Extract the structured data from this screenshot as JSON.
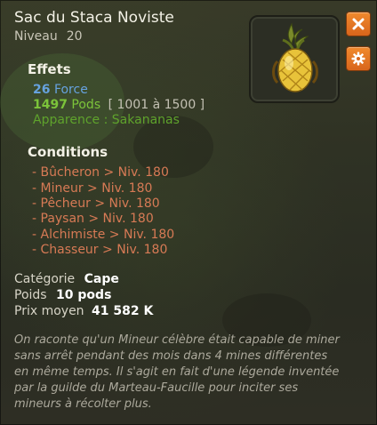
{
  "item": {
    "name": "Sac du Staca Noviste",
    "level_label": "Niveau",
    "level_value": "20"
  },
  "buttons": {
    "close_icon": "close-icon",
    "settings_icon": "gear-icon"
  },
  "effects": {
    "heading": "Effets",
    "force_value": "26",
    "force_label": "Force",
    "pods_value": "1497",
    "pods_label": "Pods",
    "pods_range": "[ 1001 à 1500 ]",
    "appearance": "Apparence : Sakananas"
  },
  "conditions": {
    "heading": "Conditions",
    "items": [
      "- Bûcheron > Niv. 180",
      "- Mineur > Niv. 180",
      "- Pêcheur > Niv. 180",
      "- Paysan > Niv. 180",
      "- Alchimiste > Niv. 180",
      "- Chasseur > Niv. 180"
    ]
  },
  "meta": {
    "category_label": "Catégorie",
    "category_value": "Cape",
    "weight_label": "Poids",
    "weight_value": "10 pods",
    "price_label": "Prix moyen",
    "price_value": "41 582 K"
  },
  "description": "On raconte qu'un Mineur célèbre était capable de miner sans arrêt pendant des mois dans 4 mines différentes en même temps. Il s'agit en fait d'une légende inventée par la guilde du Marteau-Faucille pour inciter ses mineurs à récolter plus.",
  "colors": {
    "accent_orange": "#e2741f",
    "effect_blue": "#66a2df",
    "effect_green": "#7cc43a",
    "requirement_red": "#d77a55"
  }
}
